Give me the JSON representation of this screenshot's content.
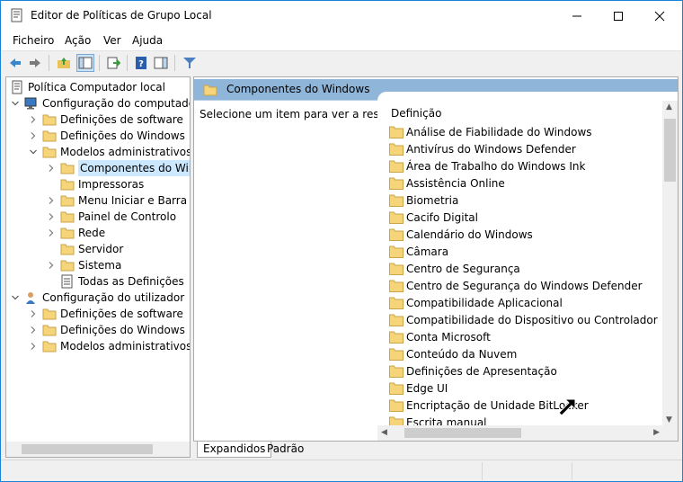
{
  "window": {
    "title": "Editor de Políticas de Grupo Local"
  },
  "menu": [
    "Ficheiro",
    "Ação",
    "Ver",
    "Ajuda"
  ],
  "toolbar": {
    "buttons": [
      "back-icon",
      "forward-icon",
      "up-folder-icon",
      "show-hide-tree-icon",
      "export-list-icon",
      "help-icon",
      "show-hide-action-icon",
      "filter-icon"
    ]
  },
  "tree": [
    {
      "label": "Política Computador local",
      "level": 0,
      "expander": "",
      "icon": "policy"
    },
    {
      "label": "Configuração do computador",
      "level": 1,
      "expander": "open",
      "icon": "computer"
    },
    {
      "label": "Definições de software",
      "level": 2,
      "expander": "closed",
      "icon": "folder"
    },
    {
      "label": "Definições do Windows",
      "level": 2,
      "expander": "closed",
      "icon": "folder"
    },
    {
      "label": "Modelos administrativos",
      "level": 2,
      "expander": "open",
      "icon": "folder"
    },
    {
      "label": "Componentes do Wind",
      "level": 3,
      "expander": "closed",
      "icon": "folder",
      "selected": true
    },
    {
      "label": "Impressoras",
      "level": 3,
      "expander": "",
      "icon": "folder"
    },
    {
      "label": "Menu Iniciar e Barra de",
      "level": 3,
      "expander": "closed",
      "icon": "folder"
    },
    {
      "label": "Painel de Controlo",
      "level": 3,
      "expander": "closed",
      "icon": "folder"
    },
    {
      "label": "Rede",
      "level": 3,
      "expander": "closed",
      "icon": "folder"
    },
    {
      "label": "Servidor",
      "level": 3,
      "expander": "",
      "icon": "folder"
    },
    {
      "label": "Sistema",
      "level": 3,
      "expander": "closed",
      "icon": "folder"
    },
    {
      "label": "Todas as Definições",
      "level": 3,
      "expander": "",
      "icon": "settings"
    },
    {
      "label": "Configuração do utilizador",
      "level": 1,
      "expander": "open",
      "icon": "user"
    },
    {
      "label": "Definições de software",
      "level": 2,
      "expander": "closed",
      "icon": "folder"
    },
    {
      "label": "Definições do Windows",
      "level": 2,
      "expander": "closed",
      "icon": "folder"
    },
    {
      "label": "Modelos administrativos",
      "level": 2,
      "expander": "closed",
      "icon": "folder"
    }
  ],
  "right": {
    "header": "Componentes do Windows",
    "description": "Selecione um item para ver a respetiva descrição.",
    "column_header": "Definição",
    "items": [
      "Análise de Fiabilidade do Windows",
      "Antivírus do Windows Defender",
      "Área de Trabalho do Windows Ink",
      "Assistência Online",
      "Biometria",
      "Cacifo Digital",
      "Calendário do Windows",
      "Câmara",
      "Centro de Segurança",
      "Centro de Segurança do Windows Defender",
      "Compatibilidade Aplicacional",
      "Compatibilidade do Dispositivo ou Controlador",
      "Conta Microsoft",
      "Conteúdo da Nuvem",
      "Definições de Apresentação",
      "Edge UI",
      "Encriptação de Unidade BitLocker",
      "Escrita manual"
    ]
  },
  "tabs": [
    "Expandidos",
    "Padrão"
  ],
  "colors": {
    "accent": "#1883d7",
    "header": "#8fb5d8",
    "selection": "#cce8ff",
    "folder": "#f5d47a"
  }
}
